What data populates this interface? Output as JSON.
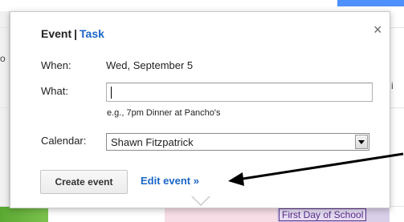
{
  "popup": {
    "tab_event": "Event",
    "tab_separator": "|",
    "tab_task": "Task",
    "close_icon": "×",
    "when_label": "When:",
    "when_value": "Wed, September 5",
    "what_label": "What:",
    "what_value": "",
    "what_hint": "e.g., 7pm Dinner at Pancho's",
    "calendar_label": "Calendar:",
    "calendar_value": "Shawn Fitzpatrick",
    "create_button": "Create event",
    "edit_link": "Edit event »"
  },
  "background": {
    "left_fragment": "o",
    "right_fragment": "i",
    "calendar_event": "First Day of School",
    "accent_blue": "#4d90fe",
    "event_color": "#5a2e8a"
  },
  "annotation": {
    "arrow_color": "#000000"
  }
}
